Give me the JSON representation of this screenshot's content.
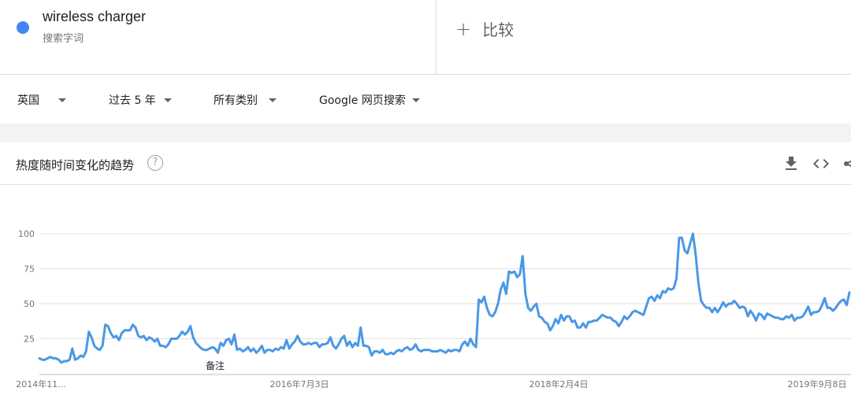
{
  "term": {
    "name": "wireless charger",
    "subtitle": "搜索字词",
    "color": "#4285f4"
  },
  "compare": {
    "plus": "+",
    "label": "比较"
  },
  "filters": {
    "region": "英国",
    "time": "过去 5 年",
    "category": "所有类别",
    "search_type": "Google 网页搜索"
  },
  "card": {
    "title": "热度随时间变化的趋势",
    "help": "?",
    "tools": [
      "download-icon",
      "embed-icon",
      "share-icon"
    ]
  },
  "chart_data": {
    "type": "line",
    "title": "",
    "xlabel": "",
    "ylabel": "",
    "ylim": [
      0,
      100
    ],
    "yticks": [
      25,
      50,
      75,
      100
    ],
    "grid": true,
    "x_tick_labels": [
      "2014年11...",
      "2016年7月3日",
      "2018年2月4日",
      "2019年9月8日"
    ],
    "annotation": "备注",
    "series": [
      {
        "color": "#4a98e6",
        "values": [
          11,
          10,
          10,
          11,
          12,
          11,
          11,
          10,
          8,
          9,
          9,
          10,
          18,
          10,
          11,
          13,
          12,
          16,
          30,
          26,
          20,
          18,
          17,
          20,
          35,
          34,
          29,
          26,
          27,
          24,
          29,
          31,
          31,
          31,
          35,
          33,
          27,
          26,
          27,
          24,
          26,
          25,
          23,
          25,
          20,
          20,
          19,
          21,
          25,
          25,
          25,
          27,
          30,
          28,
          30,
          34,
          26,
          22,
          20,
          18,
          17,
          17,
          18,
          19,
          18,
          15,
          22,
          20,
          24,
          25,
          21,
          28,
          17,
          18,
          16,
          17,
          19,
          16,
          18,
          15,
          17,
          20,
          15,
          17,
          17,
          16,
          18,
          17,
          19,
          18,
          24,
          18,
          21,
          23,
          27,
          23,
          21,
          21,
          22,
          21,
          22,
          22,
          19,
          21,
          21,
          22,
          26,
          20,
          18,
          21,
          25,
          27,
          20,
          23,
          19,
          22,
          20,
          33,
          20,
          20,
          19,
          13,
          16,
          16,
          15,
          17,
          14,
          14,
          15,
          14,
          16,
          17,
          16,
          18,
          19,
          17,
          18,
          21,
          17,
          16,
          17,
          17,
          17,
          16,
          16,
          16,
          17,
          16,
          15,
          17,
          16,
          17,
          17,
          16,
          21,
          23,
          20,
          25,
          21,
          19,
          53,
          51,
          55,
          47,
          42,
          41,
          44,
          50,
          60,
          65,
          57,
          73,
          72,
          73,
          69,
          71,
          84,
          57,
          47,
          45,
          48,
          50,
          41,
          40,
          37,
          36,
          31,
          34,
          39,
          36,
          42,
          38,
          41,
          41,
          37,
          38,
          33,
          33,
          36,
          33,
          37,
          37,
          38,
          38,
          40,
          42,
          41,
          40,
          40,
          38,
          37,
          34,
          37,
          41,
          39,
          41,
          44,
          45,
          44,
          43,
          42,
          48,
          54,
          55,
          52,
          56,
          54,
          59,
          58,
          61,
          60,
          61,
          68,
          97,
          97,
          88,
          86,
          93,
          100,
          85,
          65,
          52,
          49,
          47,
          47,
          44,
          47,
          44,
          47,
          51,
          48,
          50,
          50,
          52,
          50,
          47,
          48,
          47,
          41,
          45,
          42,
          38,
          43,
          42,
          39,
          43,
          42,
          41,
          40,
          40,
          39,
          39,
          41,
          40,
          42,
          38,
          40,
          40,
          41,
          44,
          48,
          42,
          44,
          44,
          45,
          49,
          54,
          47,
          47,
          45,
          47,
          50,
          52,
          53,
          49,
          58
        ]
      }
    ]
  }
}
